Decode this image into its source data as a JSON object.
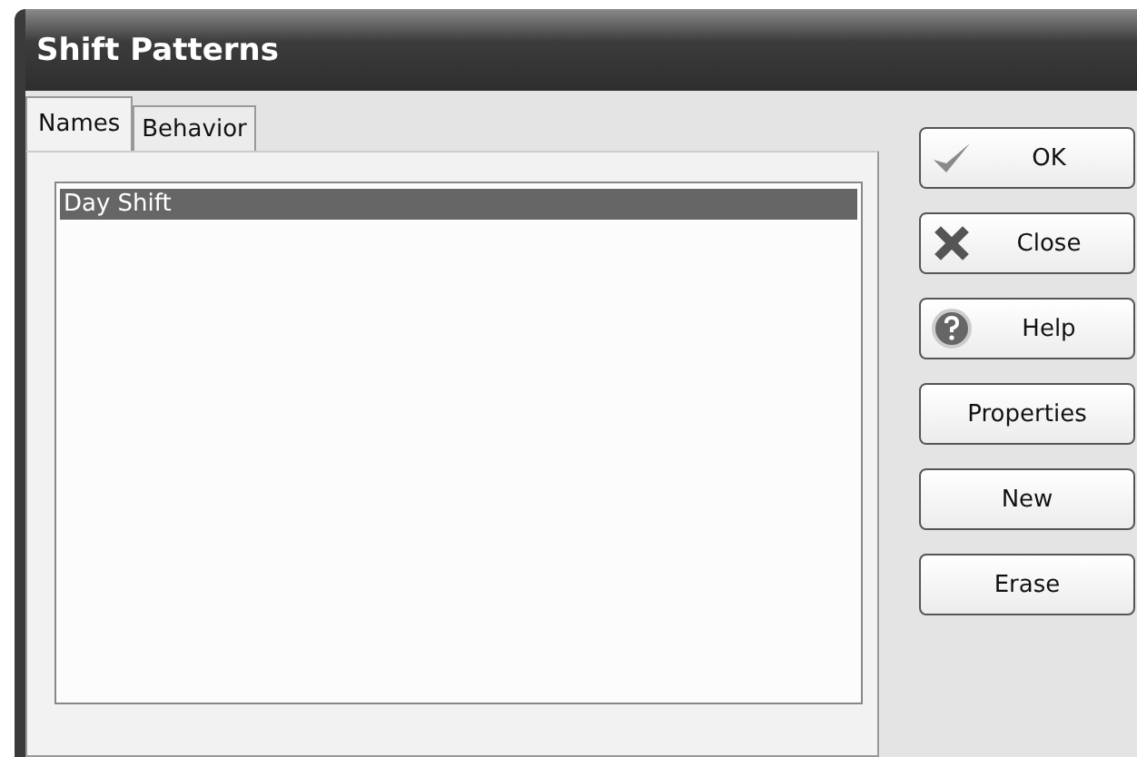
{
  "window": {
    "title": "Shift Patterns"
  },
  "tabs": [
    {
      "label": "Names",
      "selected": true
    },
    {
      "label": "Behavior",
      "selected": false
    }
  ],
  "list": {
    "items": [
      {
        "label": "Day Shift",
        "selected": true
      }
    ]
  },
  "buttons": [
    {
      "label": "OK",
      "kind": "confirm"
    },
    {
      "label": "Close",
      "kind": "dismiss"
    },
    {
      "label": "Help",
      "kind": "assist"
    },
    {
      "label": "Properties",
      "kind": "plain"
    },
    {
      "label": "New",
      "kind": "plain"
    },
    {
      "label": "Erase",
      "kind": "plain"
    }
  ]
}
